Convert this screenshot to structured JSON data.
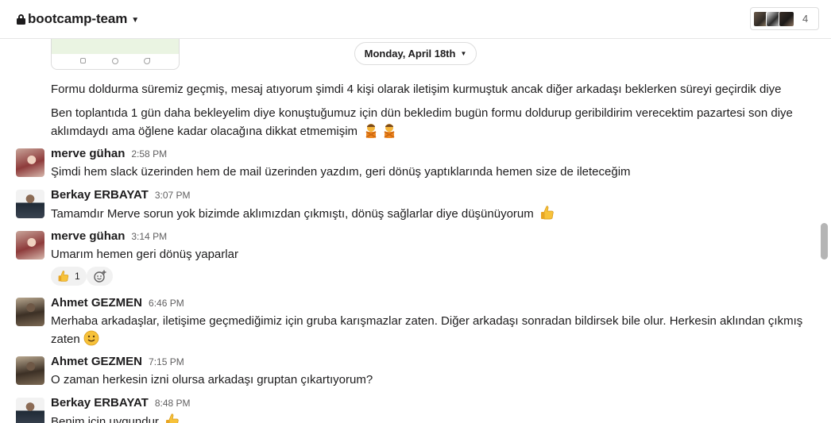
{
  "header": {
    "channel_name": "bootcamp-team",
    "member_count": "4"
  },
  "date_divider": {
    "label": "Monday, April 18th"
  },
  "continued_lines": [
    "Formu doldurma süremiz geçmiş, mesaj atıyorum şimdi 4 kişi olarak iletişim kurmuştuk ancak diğer arkadaşı beklerken süreyi geçirdik diye",
    "Ben toplantıda 1 gün daha bekleyelim diye konuştuğumuz için dün bekledim bugün formu doldurup geribildirim verecektim pazartesi son diye aklımdaydı ama öğlene kadar olacağına dikkat etmemişim"
  ],
  "messages": [
    {
      "author": "merve gühan",
      "time": "2:58 PM",
      "text": "Şimdi hem slack üzerinden hem de mail üzerinden yazdım, geri dönüş yaptıklarında hemen size de ileteceğim"
    },
    {
      "author": "Berkay ERBAYAT",
      "time": "3:07 PM",
      "text": "Tamamdır Merve sorun yok bizimde aklımızdan çıkmıştı, dönüş sağlarlar diye düşünüyorum"
    },
    {
      "author": "merve gühan",
      "time": "3:14 PM",
      "text": "Umarım hemen geri dönüş yaparlar",
      "reaction_count": "1"
    },
    {
      "author": "Ahmet GEZMEN",
      "time": "6:46 PM",
      "text": "Merhaba arkadaşlar, iletişime geçmediğimiz için gruba karışmazlar zaten. Diğer arkadaşı sonradan bildirsek bile olur. Herkesin aklından çıkmış zaten"
    },
    {
      "author": "Ahmet GEZMEN",
      "time": "7:15 PM",
      "text": "O zaman herkesin izni olursa arkadaşı gruptan çıkartıyorum?"
    },
    {
      "author": "Berkay ERBAYAT",
      "time": "8:48 PM",
      "text": "Benim için uygundur"
    }
  ],
  "colors": {
    "text": "#1d1c1d",
    "muted": "#616061",
    "border": "#dddddd",
    "reaction_bg": "#f1f1f1"
  }
}
